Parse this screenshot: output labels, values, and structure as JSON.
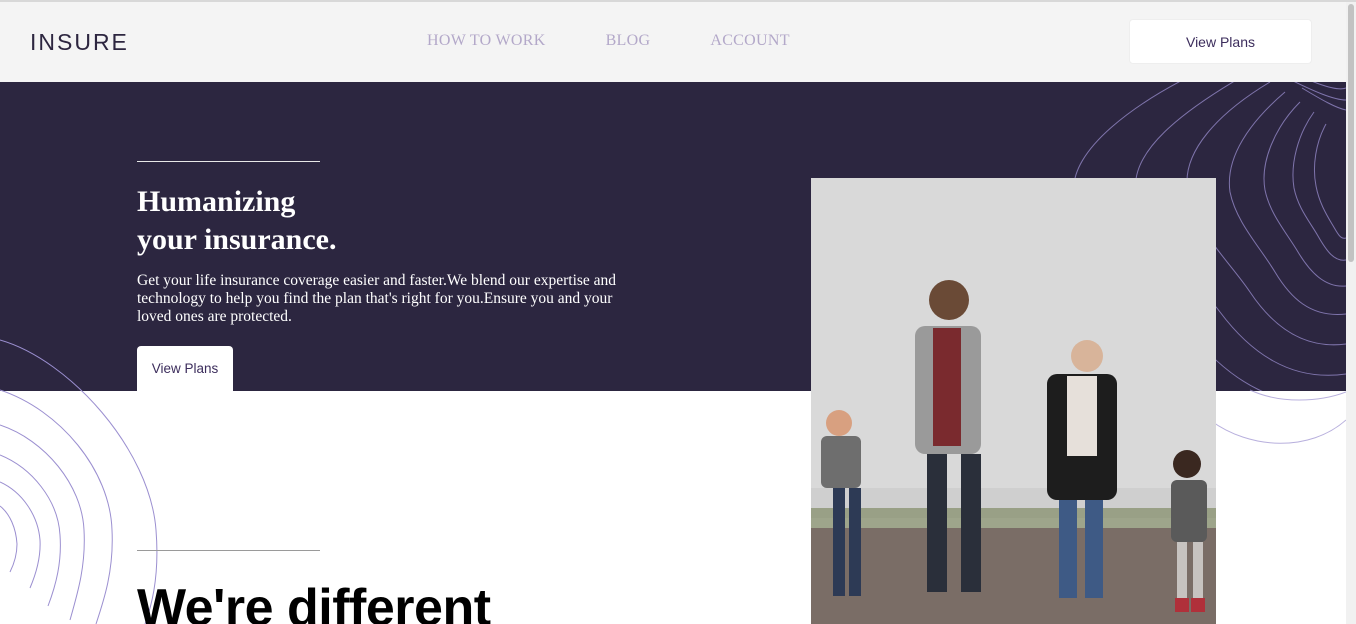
{
  "brand": {
    "logo_text": "INSURE"
  },
  "nav": {
    "items": [
      {
        "label": "HOW TO WORK"
      },
      {
        "label": "BLOG"
      },
      {
        "label": "ACCOUNT"
      }
    ],
    "cta_label": "View Plans"
  },
  "hero": {
    "title_line1": "Humanizing",
    "title_line2": "your insurance.",
    "text": "Get your life insurance coverage easier and faster.We blend our expertise and technology to help you find the plan that's right for you.Ensure you and your loved ones are protected.",
    "cta_label": "View Plans"
  },
  "section": {
    "title": "We're different"
  },
  "colors": {
    "hero_bg": "#2c2640",
    "nav_link": "#b3a8c9",
    "button_text": "#3c2d5c",
    "pattern_stroke": "#9b8fd0"
  },
  "icons": {
    "photo": "family-photo"
  }
}
